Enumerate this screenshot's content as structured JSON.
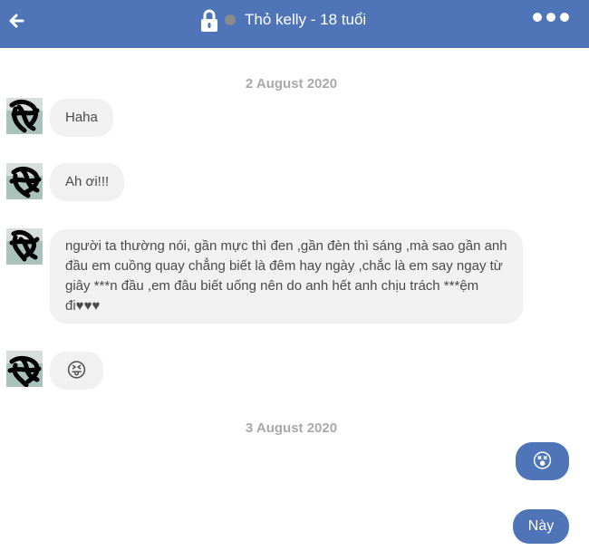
{
  "header": {
    "title": "Thỏ kelly - 18 tuổi",
    "bg_color": "#4f74b8",
    "status_color": "#8a8a8a",
    "icons": [
      "back-arrow-icon",
      "lock-icon",
      "status-dot-icon",
      "more-options-icon"
    ]
  },
  "groups": [
    {
      "date": "2 August 2020"
    },
    {
      "date": "3 August 2020"
    }
  ],
  "messages_in": [
    {
      "text": "Haha"
    },
    {
      "text": "Ah ơi!!!"
    },
    {
      "text": "người ta thường nói, gần mực thì đen ,gần đèn thì sáng ,mà sao gần anh đầu em cuồng quay chẳng biết là đêm hay ngày ,chắc là em say ngay từ giây ***n đầu ,em đâu biết uống nên do anh hết anh chịu trách ***ệm đi♥♥♥"
    },
    {
      "emoji": "😝"
    }
  ],
  "messages_out": [
    {
      "emoji": "😵"
    },
    {
      "text": "Này"
    }
  ],
  "colors": {
    "incoming_bubble": "#f1f1f1",
    "outgoing_bubble": "#4f74b8",
    "date_text": "#a9a9a9"
  }
}
